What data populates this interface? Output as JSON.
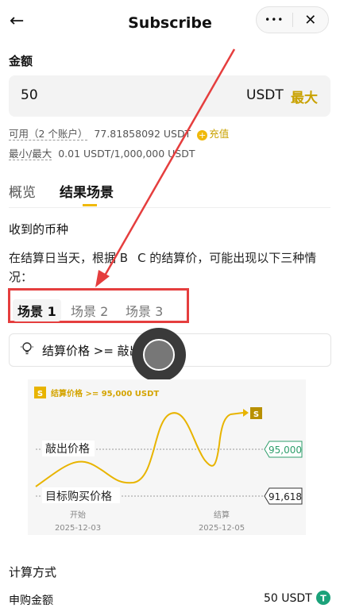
{
  "header": {
    "title": "Subscribe",
    "back_icon": "←",
    "more_icon": "•••",
    "close_icon": "✕"
  },
  "amount": {
    "label": "金额",
    "value": "50",
    "unit": "USDT",
    "max_label": "最大"
  },
  "available": {
    "label": "可用（2 个账户）",
    "value": "77.81858092 USDT",
    "recharge_label": "充值"
  },
  "limits": {
    "label": "最小/最大",
    "value": "0.01 USDT/1,000,000 USDT"
  },
  "tabs": [
    {
      "label": "概览"
    },
    {
      "label": "结果场景"
    }
  ],
  "received": {
    "title": "收到的币种",
    "description": "在结算日当天，根据 B",
    "description_after": "C 的结算价，可能出现以下三种情况："
  },
  "scenarios": [
    {
      "label": "场景 1"
    },
    {
      "label": "场景 2"
    },
    {
      "label": "场景 3"
    }
  ],
  "condition": {
    "text": "结算价格 >= 敲出"
  },
  "chart_data": {
    "type": "line",
    "title": "结算价格 >= 95,000 USDT",
    "badge": "S",
    "end_badge": "S",
    "knockout_label": "敲出价格",
    "knockout_value": "95,000",
    "target_label": "目标购买价格",
    "target_value": "91,618",
    "x_labels": [
      {
        "top": "开始",
        "bottom": "2025-12-03"
      },
      {
        "top": "结算",
        "bottom": "2025-12-05"
      }
    ]
  },
  "calc": {
    "title": "计算方式",
    "row_label": "申购金额",
    "row_value": "50 USDT"
  }
}
